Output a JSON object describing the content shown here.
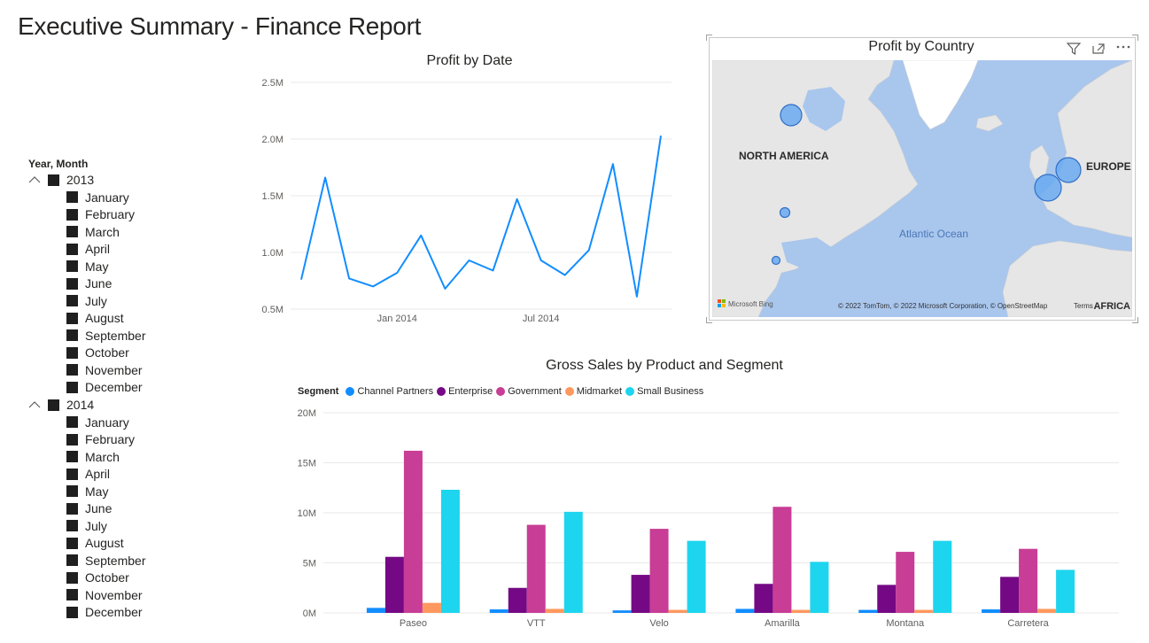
{
  "page_title": "Executive Summary - Finance Report",
  "slicer": {
    "header": "Year, Month",
    "years": [
      {
        "label": "2013",
        "months": [
          "January",
          "February",
          "March",
          "April",
          "May",
          "June",
          "July",
          "August",
          "September",
          "October",
          "November",
          "December"
        ]
      },
      {
        "label": "2014",
        "months": [
          "January",
          "February",
          "March",
          "April",
          "May",
          "June",
          "July",
          "August",
          "September",
          "October",
          "November",
          "December"
        ]
      }
    ]
  },
  "icons": {
    "filter": "filter-icon",
    "focus": "focus-mode-icon",
    "more": "more-options-icon",
    "collapse": "chevron-up-icon"
  },
  "map": {
    "title": "Profit by Country",
    "labels": {
      "north_america": "NORTH AMERICA",
      "europe": "EUROPE",
      "ocean": "Atlantic Ocean",
      "africa": "AFRICA"
    },
    "attribution": "© 2022 TomTom, © 2022 Microsoft Corporation, © OpenStreetMap",
    "attribution_link": "Terms",
    "brand": "Microsoft Bing",
    "colors": {
      "water": "#a9c6ed",
      "land": "#e9e9e9",
      "bubble": "#6aaaf0",
      "bubble_stroke": "#2f6fc7"
    }
  },
  "colors": {
    "line": "#118DFF",
    "grid": "#e8e8e8",
    "axis_text": "#605e5c"
  },
  "chart_data": [
    {
      "type": "line",
      "title": "Profit by Date",
      "x_ticks": [
        "Jan 2014",
        "Jul 2014"
      ],
      "y_ticks": [
        "0.5M",
        "1.0M",
        "1.5M",
        "2.0M",
        "2.5M"
      ],
      "ylim": [
        0.5,
        2.5
      ],
      "y_unit": "M",
      "grid": true,
      "x": [
        "2013-09",
        "2013-10",
        "2013-11",
        "2013-12",
        "2014-01",
        "2014-02",
        "2014-03",
        "2014-04",
        "2014-05",
        "2014-06",
        "2014-07",
        "2014-08",
        "2014-09",
        "2014-10",
        "2014-11",
        "2014-12"
      ],
      "values": [
        0.76,
        1.66,
        0.77,
        0.7,
        0.82,
        1.15,
        0.68,
        0.93,
        0.84,
        1.47,
        0.93,
        0.8,
        1.02,
        1.78,
        0.61,
        2.03
      ]
    },
    {
      "type": "bar",
      "title": "Gross Sales by Product and Segment",
      "legend_title": "Segment",
      "legend_position": "top-left",
      "categories": [
        "Paseo",
        "VTT",
        "Velo",
        "Amarilla",
        "Montana",
        "Carretera"
      ],
      "y_ticks": [
        "0M",
        "5M",
        "10M",
        "15M",
        "20M"
      ],
      "ylim": [
        0,
        20
      ],
      "y_unit": "M",
      "grid": true,
      "series": [
        {
          "name": "Channel Partners",
          "color": "#118DFF",
          "values": [
            0.5,
            0.35,
            0.25,
            0.4,
            0.3,
            0.35
          ]
        },
        {
          "name": "Enterprise",
          "color": "#750985",
          "values": [
            5.6,
            2.5,
            3.8,
            2.9,
            2.8,
            3.6
          ]
        },
        {
          "name": "Government",
          "color": "#C83D95",
          "values": [
            16.2,
            8.8,
            8.4,
            10.6,
            6.1,
            6.4
          ]
        },
        {
          "name": "Midmarket",
          "color": "#FF985E",
          "values": [
            1.0,
            0.4,
            0.3,
            0.3,
            0.3,
            0.4
          ]
        },
        {
          "name": "Small Business",
          "color": "#1DD5EE",
          "values": [
            12.3,
            10.1,
            7.2,
            5.1,
            7.2,
            4.3
          ]
        }
      ]
    }
  ]
}
